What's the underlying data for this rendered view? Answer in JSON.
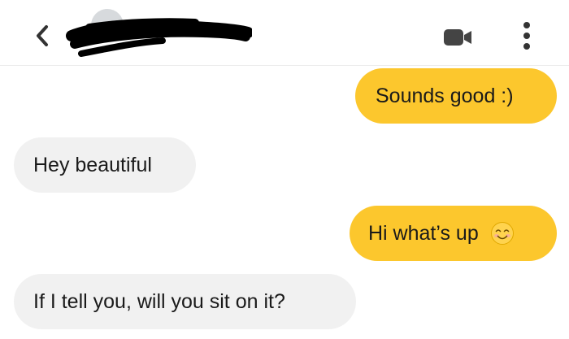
{
  "header": {
    "back_icon": "chevron-left-icon",
    "contact_name_redacted": true,
    "video_icon": "video-camera-icon",
    "more_icon": "more-vertical-icon"
  },
  "colors": {
    "outgoing_bubble": "#fcc72d",
    "incoming_bubble": "#f1f1f1",
    "text": "#1a1a1a",
    "icon": "#333333"
  },
  "messages": [
    {
      "direction": "outgoing",
      "text": "Sounds good :)"
    },
    {
      "direction": "incoming",
      "text": "Hey beautiful"
    },
    {
      "direction": "outgoing",
      "text": "Hi what’s up",
      "emoji": "smiling-face-icon"
    },
    {
      "direction": "incoming",
      "text": "If I tell you, will you sit on it?"
    }
  ]
}
